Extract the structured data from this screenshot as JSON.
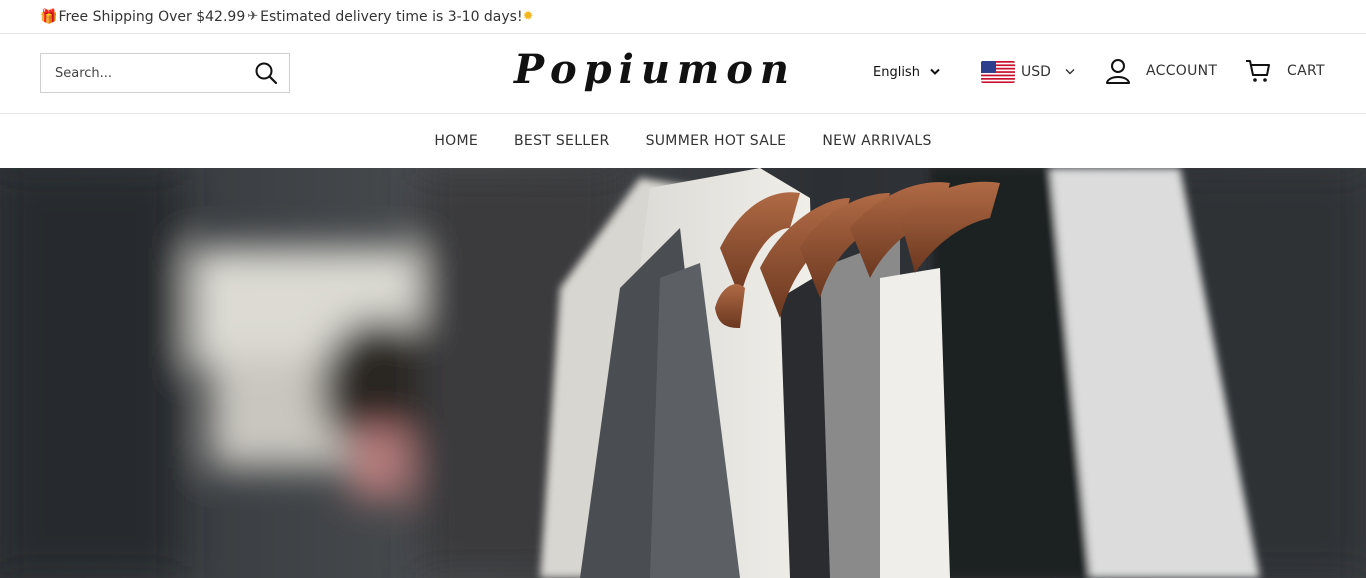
{
  "announcement": {
    "gift_icon": "gift-icon",
    "text_before": "Free Shipping Over $42.99",
    "plane_icon": "airplane-icon",
    "text_after": " Estimated delivery time is 3-10 days!",
    "sun_icon": "sun-icon"
  },
  "header": {
    "search": {
      "placeholder": "Search...",
      "icon": "search-icon"
    },
    "logo": "Popiumon",
    "language": {
      "selected": "English",
      "icon": "chevron-down-icon"
    },
    "currency": {
      "selected": "USD",
      "flag": "us-flag-icon",
      "icon": "chevron-down-icon"
    },
    "account_label": "ACCOUNT",
    "cart_label": "CART"
  },
  "nav": {
    "items": [
      {
        "label": "HOME"
      },
      {
        "label": "BEST SELLER"
      },
      {
        "label": "SUMMER HOT SALE"
      },
      {
        "label": "NEW ARRIVALS"
      }
    ]
  },
  "colors": {
    "accent_gift": "#27b3c4",
    "sun": "#f3b51c",
    "text": "#333333",
    "border": "#e3e3e3"
  }
}
